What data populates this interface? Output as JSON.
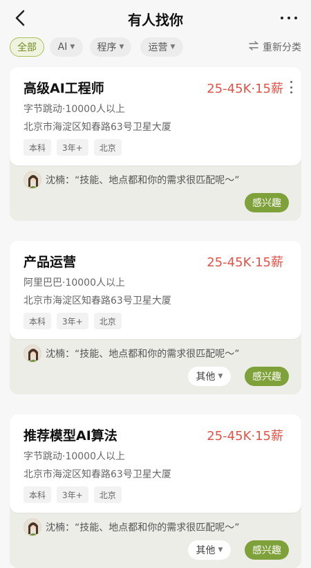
{
  "header": {
    "title": "有人找你",
    "back_icon": "chevron-left-icon",
    "more_icon": "more-horizontal-icon"
  },
  "filters": {
    "chips": [
      {
        "label": "全部",
        "active": true,
        "dropdown": false
      },
      {
        "label": "AI",
        "active": false,
        "dropdown": true
      },
      {
        "label": "程序",
        "active": false,
        "dropdown": true
      },
      {
        "label": "运营",
        "active": false,
        "dropdown": true
      }
    ],
    "regroup_label": "重新分类",
    "regroup_icon": "swap-arrows-icon"
  },
  "colors": {
    "accent": "#7fa13a",
    "salary": "#e35247"
  },
  "jobs": [
    {
      "title": "高级AI工程师",
      "salary": "25-45K·15薪",
      "company": "字节跳动·10000人以上",
      "address": "北京市海淀区知春路63号卫星大厦",
      "tags": [
        "本科",
        "3年+",
        "北京"
      ],
      "recruiter_quote": "沈楠：“技能、地点都和你的需求很匹配呢～”",
      "interest_label": "感兴趣",
      "other_label": "",
      "has_kebab": true
    },
    {
      "title": "产品运营",
      "salary": "25-45K·15薪",
      "company": "阿里巴巴·10000人以上",
      "address": "北京市海淀区知春路63号卫星大厦",
      "tags": [
        "本科",
        "3年+",
        "北京"
      ],
      "recruiter_quote": "沈楠：“技能、地点都和你的需求很匹配呢～”",
      "interest_label": "感兴趣",
      "other_label": "其他",
      "has_kebab": false
    },
    {
      "title": "推荐模型AI算法",
      "salary": "25-45K·15薪",
      "company": "字节跳动·10000人以上",
      "address": "北京市海淀区知春路63号卫星大厦",
      "tags": [
        "本科",
        "3年+",
        "北京"
      ],
      "recruiter_quote": "沈楠：“技能、地点都和你的需求很匹配呢～”",
      "interest_label": "感兴趣",
      "other_label": "其他",
      "has_kebab": false
    }
  ]
}
